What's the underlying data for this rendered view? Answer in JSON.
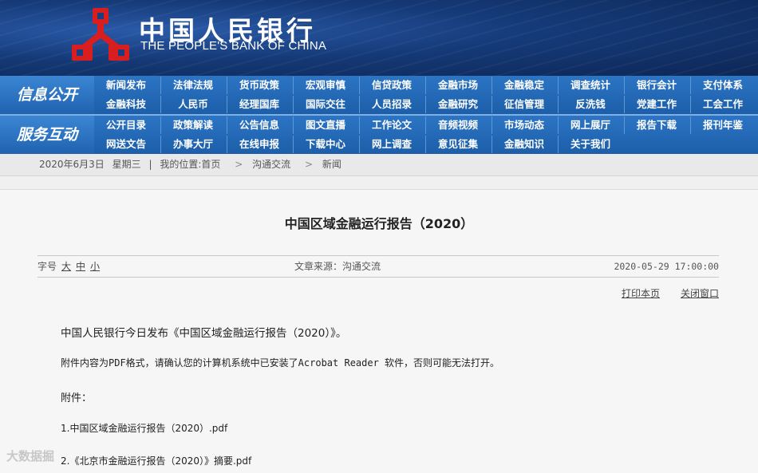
{
  "header": {
    "name_cn": "中国人民银行",
    "name_en": "THE PEOPLE'S BANK OF CHINA",
    "logo_icon": "pboc-logo-icon",
    "logo_color": "#d81e1e"
  },
  "nav": {
    "info": {
      "label": "信息公开",
      "row1": [
        "新闻发布",
        "法律法规",
        "货币政策",
        "宏观审慎",
        "信贷政策",
        "金融市场",
        "金融稳定",
        "调查统计",
        "银行会计",
        "支付体系"
      ],
      "row2": [
        "金融科技",
        "人民币",
        "经理国库",
        "国际交往",
        "人员招录",
        "金融研究",
        "征信管理",
        "反洗钱",
        "党建工作",
        "工会工作"
      ]
    },
    "service": {
      "label": "服务互动",
      "row1": [
        "公开目录",
        "政策解读",
        "公告信息",
        "图文直播",
        "工作论文",
        "音频视频",
        "市场动态",
        "网上展厅",
        "报告下载",
        "报刊年鉴"
      ],
      "row2": [
        "网送文告",
        "办事大厅",
        "在线申报",
        "下载中心",
        "网上调查",
        "意见征集",
        "金融知识",
        "关于我们"
      ]
    }
  },
  "breadcrumb": {
    "date": "2020年6月3日",
    "weekday": "星期三",
    "sep": "|",
    "location_label": "我的位置:首页",
    "gt": ">",
    "level1": "沟通交流",
    "level2": "新闻"
  },
  "article": {
    "title": "中国区域金融运行报告（2020）",
    "font_label": "字号",
    "font_sizes": [
      "大",
      "中",
      "小"
    ],
    "source": "文章来源：沟通交流",
    "time": "2020-05-29 17:00:00",
    "print_label": "打印本页",
    "close_label": "关闭窗口",
    "para1": "中国人民银行今日发布《中国区域金融运行报告（2020）》。",
    "para2": "附件内容为PDF格式，请确认您的计算机系统中已安装了Acrobat Reader 软件，否则可能无法打开。",
    "attach_label": "附件：",
    "attachments": [
      "1.中国区域金融运行报告（2020）.pdf",
      "2.《北京市金融运行报告（2020）》摘要.pdf"
    ]
  },
  "watermark": {
    "text": "大数据掘"
  }
}
